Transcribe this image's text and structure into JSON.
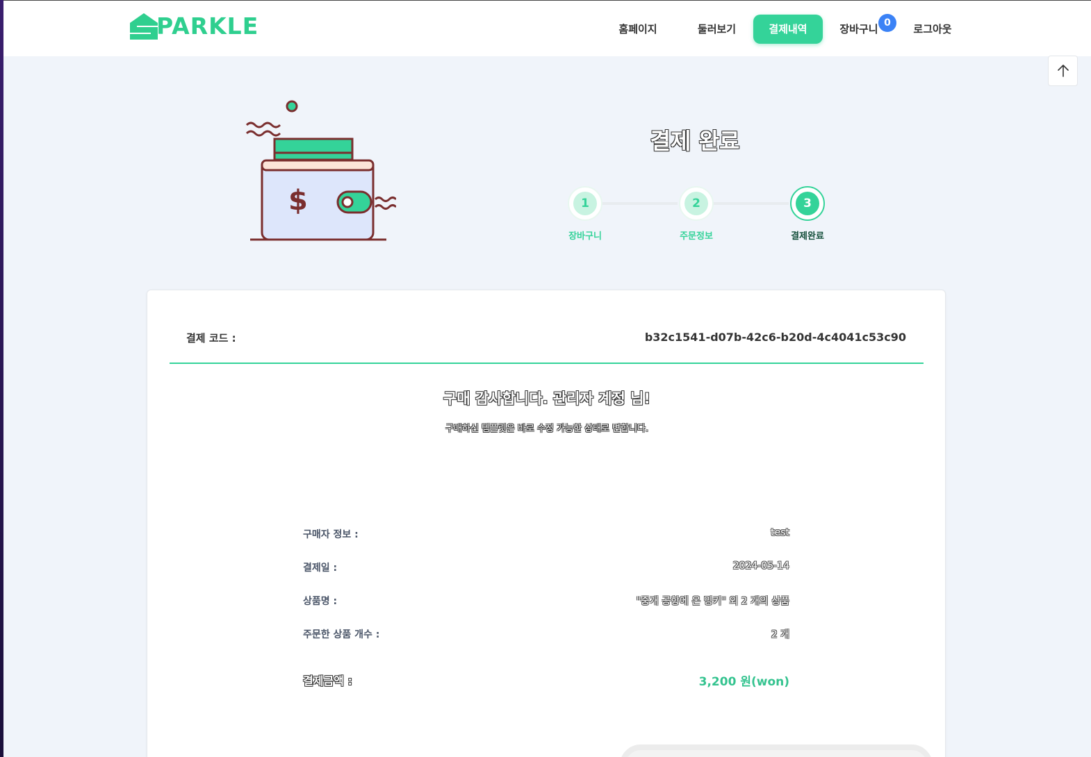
{
  "brand": {
    "name": "PARKLE",
    "color": "#2fcf8f"
  },
  "nav": {
    "home": "홈페이지",
    "browse": "둘러보기",
    "orders": "결제내역",
    "cart": "장바구니",
    "cart_count": "0",
    "logout": "로그아웃"
  },
  "icons": {
    "scroll_top": "arrow-up-icon",
    "hero": "wallet-illustration",
    "currency": "$"
  },
  "hero": {
    "title": "결제 완료"
  },
  "steps": [
    {
      "number": "1",
      "label": "장바구니"
    },
    {
      "number": "2",
      "label": "주문정보"
    },
    {
      "number": "3",
      "label": "결제완료"
    }
  ],
  "order": {
    "code_label": "결제 코드 :",
    "code_value": "b32c1541-d07b-42c6-b20d-4c4041c53c90",
    "thanks": "구매 감사합니다. 관리자 계정 님!",
    "subtitle": "구매하신 템플릿은 바로 수정 가능한 상태로 변합니다.",
    "buyer_label": "구매자 정보 :",
    "buyer_value": "test",
    "date_label": "결제일 :",
    "date_value": "2024-05-14",
    "product_label": "상품명 :",
    "product_value": "\"중개 공항에 온 밍키\" 외 2 개의 상품",
    "count_label": "주문한 상품 개수 :",
    "count_value": "2 개",
    "total_label": "결제금액 :",
    "total_value": "3,200 원(won)"
  },
  "colors": {
    "accent": "#34d399",
    "badge": "#3b82f6",
    "background": "#f0f4fa"
  }
}
